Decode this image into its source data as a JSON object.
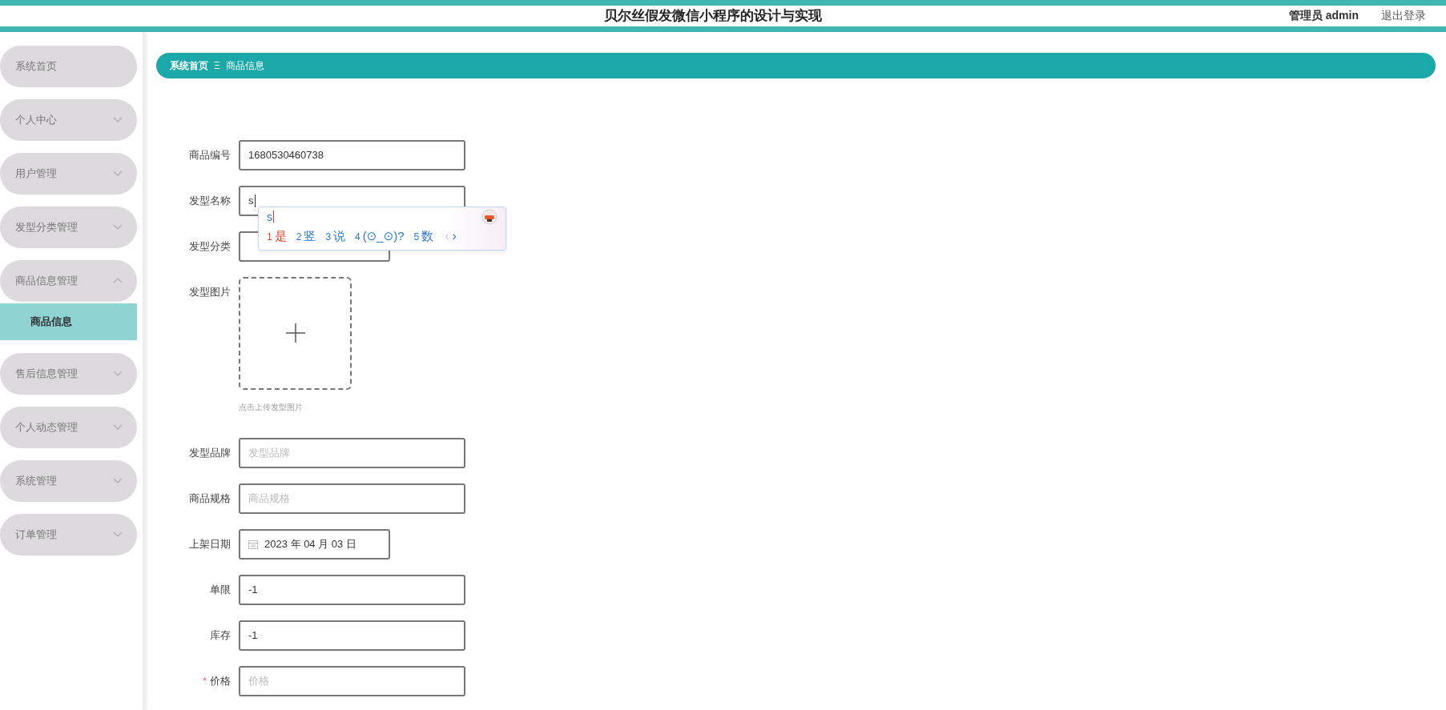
{
  "header": {
    "title": "贝尔丝假发微信小程序的设计与实现",
    "user": "管理员 admin",
    "logout": "退出登录"
  },
  "sidebar": {
    "items": [
      {
        "label": "系统首页",
        "kind": "link"
      },
      {
        "label": "个人中心",
        "kind": "menu",
        "expanded": false
      },
      {
        "label": "用户管理",
        "kind": "menu",
        "expanded": false
      },
      {
        "label": "发型分类管理",
        "kind": "menu",
        "expanded": false
      },
      {
        "label": "商品信息管理",
        "kind": "menu",
        "expanded": true,
        "children": [
          {
            "label": "商品信息",
            "selected": true
          }
        ]
      },
      {
        "label": "售后信息管理",
        "kind": "menu",
        "expanded": false
      },
      {
        "label": "个人动态管理",
        "kind": "menu",
        "expanded": false
      },
      {
        "label": "系统管理",
        "kind": "menu",
        "expanded": false
      },
      {
        "label": "订单管理",
        "kind": "menu",
        "expanded": false
      }
    ]
  },
  "breadcrumb": {
    "items": [
      "系统首页",
      "商品信息"
    ],
    "separator": "Ξ"
  },
  "form": {
    "fields": [
      {
        "label": "商品编号",
        "kind": "text",
        "value": "1680530460738",
        "wide": true
      },
      {
        "label": "发型名称",
        "kind": "text",
        "value": "s",
        "wide": true,
        "focused": true
      },
      {
        "label": "发型分类",
        "kind": "select",
        "wide": false
      },
      {
        "label": "发型图片",
        "kind": "upload",
        "hint": "点击上传发型图片"
      },
      {
        "label": "发型品牌",
        "kind": "text",
        "placeholder": "发型品牌",
        "wide": true
      },
      {
        "label": "商品规格",
        "kind": "text",
        "placeholder": "商品规格",
        "wide": true
      },
      {
        "label": "上架日期",
        "kind": "date",
        "value": "2023 年 04 月 03 日",
        "wide": false
      },
      {
        "label": "单限",
        "kind": "text",
        "value": "-1",
        "wide": true
      },
      {
        "label": "库存",
        "kind": "text",
        "value": "-1",
        "wide": true
      },
      {
        "label": "价格",
        "kind": "text",
        "placeholder": "价格",
        "required_mark": "*",
        "wide": true
      }
    ]
  },
  "ime": {
    "composition": "s",
    "candidates": [
      {
        "number": "1",
        "text": "是",
        "selected": true
      },
      {
        "number": "2",
        "text": "竖",
        "selected": false
      },
      {
        "number": "3",
        "text": "说",
        "selected": false
      },
      {
        "number": "4",
        "text": "(⊙_⊙)?",
        "selected": false
      },
      {
        "number": "5",
        "text": "数",
        "selected": false
      }
    ],
    "prev": "‹",
    "next": "›"
  }
}
